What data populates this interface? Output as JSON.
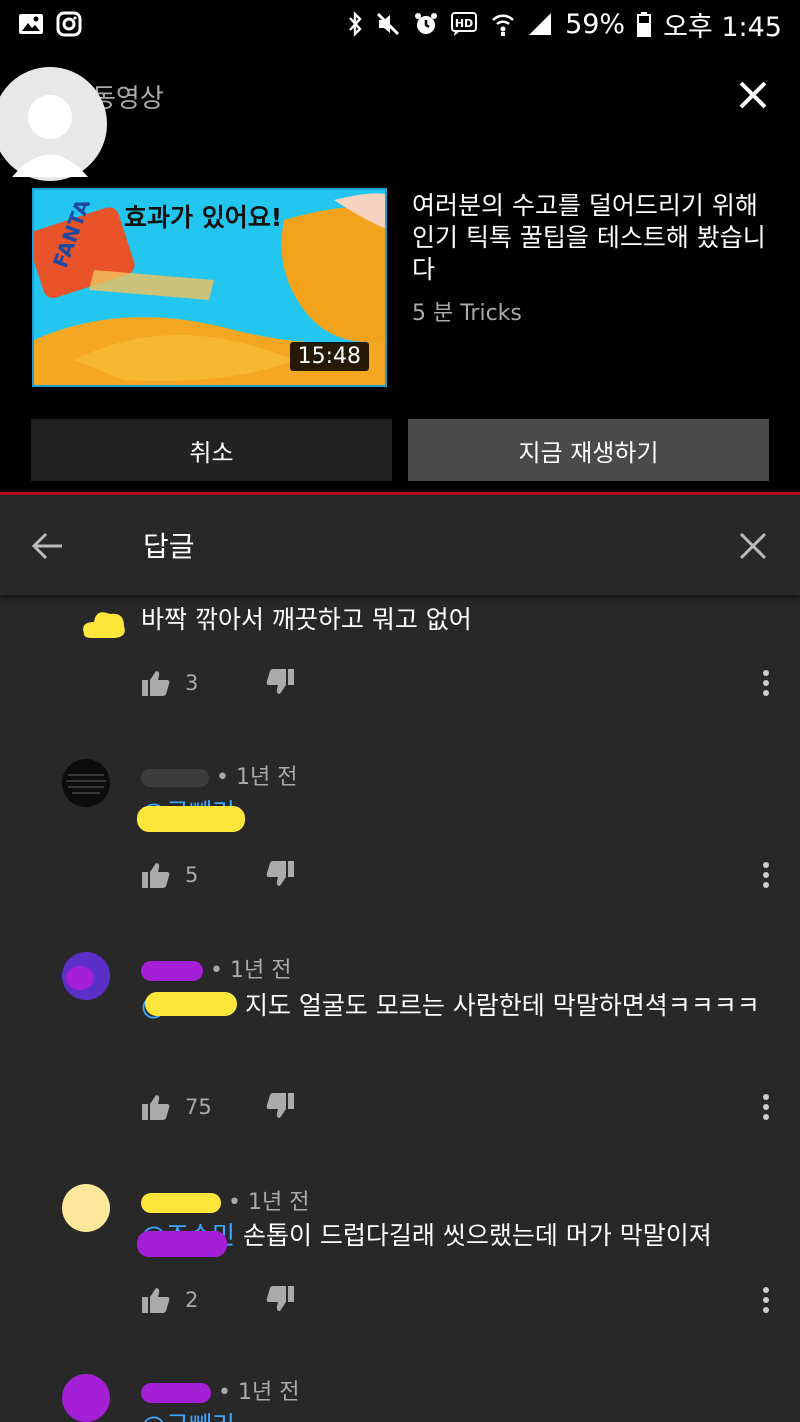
{
  "status_bar": {
    "battery": "59%",
    "time": "오후 1:45"
  },
  "up_next": {
    "label": "동영상",
    "thumbnail_text": "효과가 있어요!",
    "duration": "15:48",
    "video_title": "여러분의 수고를 덜어드리기 위해 인기 틱톡 꿀팁을 테스트해 봤습니다",
    "channel": "5 분 Tricks",
    "cancel_label": "취소",
    "play_label": "지금 재생하기"
  },
  "replies": {
    "title": "답글",
    "comments": [
      {
        "author": "",
        "time": "",
        "mention": "",
        "text": "바짝 깎아서 깨끗하고 뭐고 없어",
        "likes": "3"
      },
      {
        "author": "",
        "time": "1년 전",
        "mention": "@구빼리",
        "text": ".",
        "likes": "5"
      },
      {
        "author": "",
        "time": "1년 전",
        "mention": "@",
        "text": "지도 얼굴도 모르는 사람한테 막말하면셕ㅋㅋㅋㅋ",
        "likes": "75"
      },
      {
        "author": "",
        "time": "1년 전",
        "mention": "@조수민",
        "text": "손톱이 드럽다길래 씻으랬는데 머가 막말이져",
        "likes": "2"
      },
      {
        "author": "",
        "time": "1년 전",
        "mention": "@구빼리",
        "text": "",
        "likes": ""
      }
    ]
  },
  "colors": {
    "link": "#3ea6ff",
    "accent_red": "#b3121f"
  }
}
